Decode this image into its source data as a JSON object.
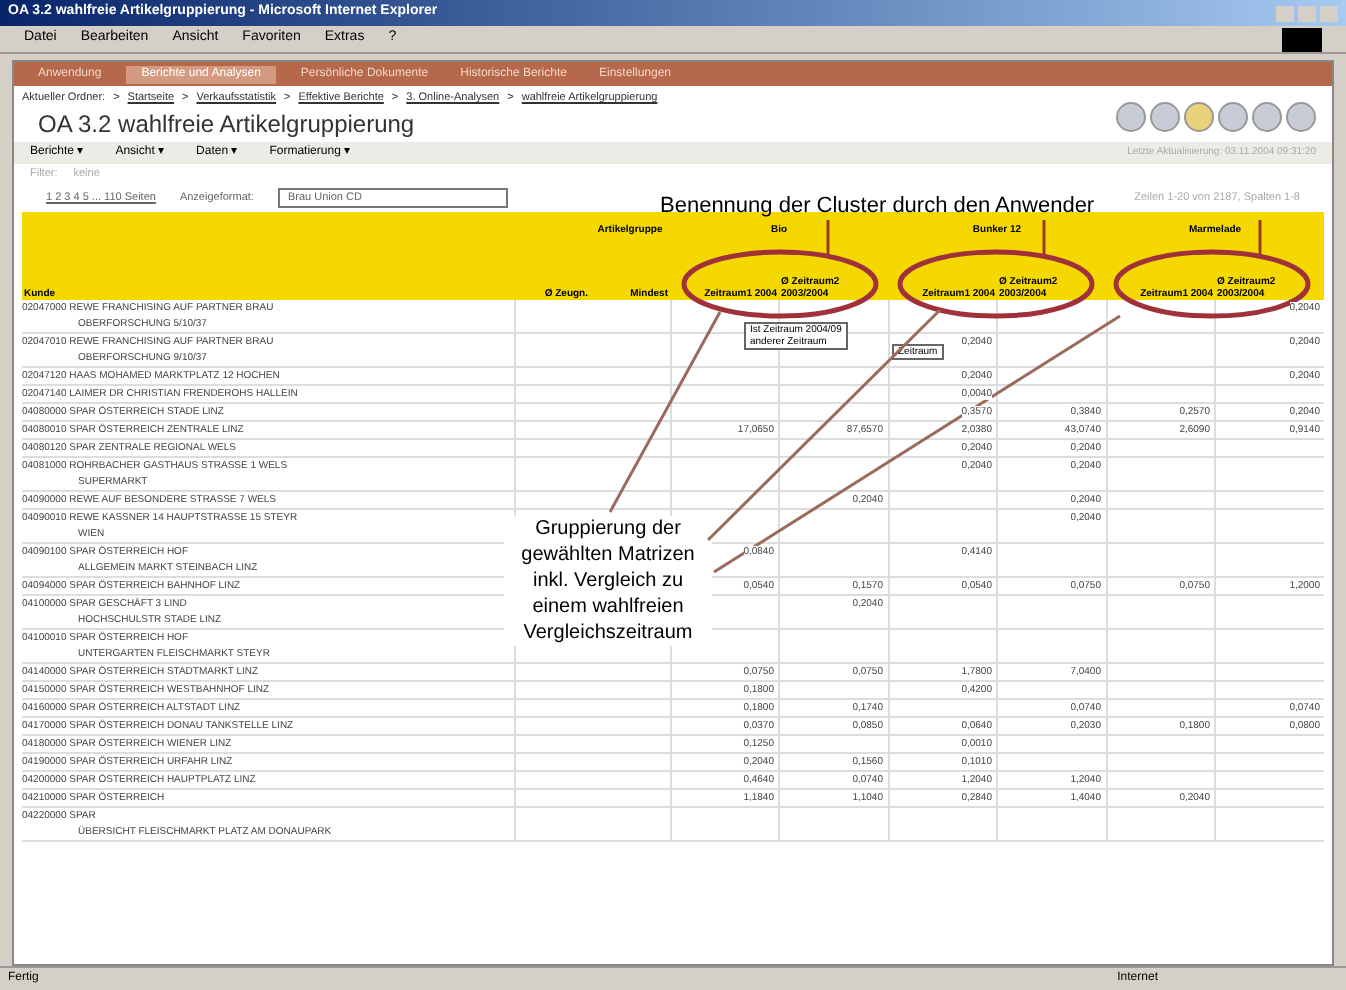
{
  "window": {
    "title": "OA 3.2 wahlfreie Artikelgruppierung - Microsoft Internet Explorer"
  },
  "menu": [
    "Datei",
    "Bearbeiten",
    "Ansicht",
    "Favoriten",
    "Extras",
    "?"
  ],
  "nav_tabs": [
    {
      "label": "Anwendung",
      "selected": false
    },
    {
      "label": "Berichte und Analysen",
      "selected": true
    },
    {
      "label": "Persönliche Dokumente",
      "selected": false
    },
    {
      "label": "Historische Berichte",
      "selected": false
    },
    {
      "label": "Einstellungen",
      "selected": false
    }
  ],
  "breadcrumb": {
    "separator": ">",
    "items": [
      "Aktueller Ordner:",
      "Startseite",
      "Verkaufsstatistik",
      "Effektive Berichte",
      "3. Online-Analysen",
      "wahlfreie Artikelgruppierung"
    ]
  },
  "page_title": "OA 3.2 wahlfreie Artikelgruppierung",
  "toolbar": [
    "Berichte ▾",
    "Ansicht ▾",
    "Daten ▾",
    "Formatierung ▾"
  ],
  "last_update": "Letzte Aktualisierung: 03.11.2004 09:31:20",
  "filter": {
    "label": "Filter:",
    "value": "keine"
  },
  "paging": {
    "pages": "1 2 3 4 5 ... 110 Seiten",
    "format_label": "Anzeigeformat:",
    "format_value": "Brau Union CD",
    "info": "Zeilen 1-20 von 2187, Spalten 1-8"
  },
  "table": {
    "group_headers": [
      "Artikelgruppe",
      "Bio",
      "Bunker 12",
      "Marmelade"
    ],
    "columns": [
      "Kunde",
      "Ø Zeugn.",
      "Mindest",
      "Zeitraum1 2004",
      "Ø Zeitraum2 2003/2004",
      "Zeitraum1 2004",
      "Ø Zeitraum2 2003/2004",
      "Zeitraum1 2004",
      "Ø Zeitraum2 2003/2004"
    ],
    "popups": [
      [
        "Ist Zeitraum 2004/09",
        "anderer Zeitraum"
      ],
      [
        "Zeitraum"
      ]
    ],
    "rows": [
      {
        "name": [
          "02047000 REWE FRANCHISING AUF PARTNER BRAU",
          "OBERFORSCHUNG 5/10/37"
        ],
        "values": {
          "marmelade_2": "0,2040"
        }
      },
      {
        "name": [
          "02047010 REWE FRANCHISING AUF PARTNER BRAU",
          "OBERFORSCHUNG 9/10/37"
        ],
        "values": {
          "bunker_1": "0,2040",
          "marmelade_2": "0,2040"
        }
      },
      {
        "name": [
          "02047120 HAAS MOHAMED MARKTPLATZ 12 HOCHEN"
        ],
        "values": {
          "bunker_1": "0,2040",
          "marmelade_2": "0,2040"
        }
      },
      {
        "name": [
          "02047140 LAIMER DR CHRISTIAN FRENDEROHS HALLEIN"
        ],
        "values": {
          "bunker_1": "0,0040"
        }
      },
      {
        "name": [
          "04080000 SPAR ÖSTERREICH STADE LINZ"
        ],
        "values": {
          "bunker_1": "0,3570",
          "bunker_2": "0,3840",
          "marmelade_1": "0,2570",
          "marmelade_2": "0,2040"
        }
      },
      {
        "name": [
          "04080010 SPAR ÖSTERREICH ZENTRALE LINZ"
        ],
        "values": {
          "bio_1": "17,0650",
          "bio_2": "87,6570",
          "bunker_1": "2,0380",
          "bunker_2": "43,0740",
          "marmelade_1": "2,6090",
          "marmelade_2": "0,9140"
        }
      },
      {
        "name": [
          "04080120 SPAR ZENTRALE REGIONAL WELS"
        ],
        "values": {
          "bunker_1": "0,2040",
          "bunker_2": "0,2040"
        }
      },
      {
        "name": [
          "04081000 ROHRBACHER GASTHAUS STRASSE 1 WELS",
          "SUPERMARKT"
        ],
        "values": {
          "bunker_1": "0,2040",
          "bunker_2": "0,2040"
        }
      },
      {
        "name": [
          "04090000 REWE AUF BESONDERE STRASSE 7 WELS"
        ],
        "values": {
          "bio_2": "0,2040",
          "bunker_2": "0,2040"
        }
      },
      {
        "name": [
          "04090010 REWE KASSNER 14 HAUPTSTRASSE 15 STEYR",
          "WIEN"
        ],
        "values": {
          "bunker_2": "0,2040"
        }
      },
      {
        "name": [
          "04090100 SPAR ÖSTERREICH HOF",
          "ALLGEMEIN MARKT STEINBACH LINZ"
        ],
        "values": {
          "bio_1": "0,0840",
          "bunker_1": "0,4140"
        }
      },
      {
        "name": [
          "04094000 SPAR ÖSTERREICH BAHNHOF LINZ"
        ],
        "values": {
          "bio_1": "0,0540",
          "bio_2": "0,1570",
          "bunker_1": "0,0540",
          "bunker_2": "0,0750",
          "marmelade_1": "0,0750",
          "marmelade_2": "1,2000"
        }
      },
      {
        "name": [
          "04100000 SPAR GESCHÄFT 3 LIND",
          "HOCHSCHULSTR STADE LINZ"
        ],
        "values": {
          "bio_2": "0,2040"
        }
      },
      {
        "name": [
          "04100010 SPAR ÖSTERREICH HOF",
          "UNTERGARTEN FLEISCHMARKT STEYR"
        ],
        "values": {}
      },
      {
        "name": [
          "04140000 SPAR ÖSTERREICH STADTMARKT LINZ"
        ],
        "values": {
          "bio_1": "0,0750",
          "bio_2": "0,0750",
          "bunker_1": "1,7800",
          "bunker_2": "7,0400"
        }
      },
      {
        "name": [
          "04150000 SPAR ÖSTERREICH WESTBAHNHOF LINZ"
        ],
        "values": {
          "bio_1": "0,1800",
          "bunker_1": "0,4200"
        }
      },
      {
        "name": [
          "04160000 SPAR ÖSTERREICH ALTSTADT LINZ"
        ],
        "values": {
          "bio_1": "0,1800",
          "bio_2": "0,1740",
          "bunker_2": "0,0740",
          "marmelade_2": "0,0740"
        }
      },
      {
        "name": [
          "04170000 SPAR ÖSTERREICH DONAU TANKSTELLE LINZ"
        ],
        "values": {
          "bio_1": "0,0370",
          "bio_2": "0,0850",
          "bunker_1": "0,0640",
          "bunker_2": "0,2030",
          "marmelade_1": "0,1800",
          "marmelade_2": "0,0800"
        }
      },
      {
        "name": [
          "04180000 SPAR ÖSTERREICH WIENER LINZ"
        ],
        "values": {
          "bio_1": "0,1250",
          "bunker_1": "0,0010"
        }
      },
      {
        "name": [
          "04190000 SPAR ÖSTERREICH URFAHR LINZ"
        ],
        "values": {
          "bio_1": "0,2040",
          "bio_2": "0,1560",
          "bunker_1": "0,1010"
        }
      },
      {
        "name": [
          "04200000 SPAR ÖSTERREICH HAUPTPLATZ LINZ"
        ],
        "values": {
          "bio_1": "0,4640",
          "bio_2": "0,0740",
          "bunker_1": "1,2040",
          "bunker_2": "1,2040"
        }
      },
      {
        "name": [
          "04210000 SPAR ÖSTERREICH"
        ],
        "values": {
          "bio_1": "1,1840",
          "bio_2": "1,1040",
          "bunker_1": "0,2840",
          "bunker_2": "1,4040",
          "marmelade_1": "0,2040"
        }
      },
      {
        "name": [
          "04220000 SPAR",
          "ÜBERSICHT FLEISCHMARKT PLATZ AM DONAUPARK"
        ],
        "values": {}
      }
    ]
  },
  "annotations": {
    "top": "Benennung der Cluster durch den Anwender",
    "bottom": "Gruppierung der gewählten Matrizen inkl. Vergleich zu einem wahlfreien Vergleichszeitraum"
  },
  "status_bar": {
    "left": "Fertig",
    "right": "Internet"
  }
}
